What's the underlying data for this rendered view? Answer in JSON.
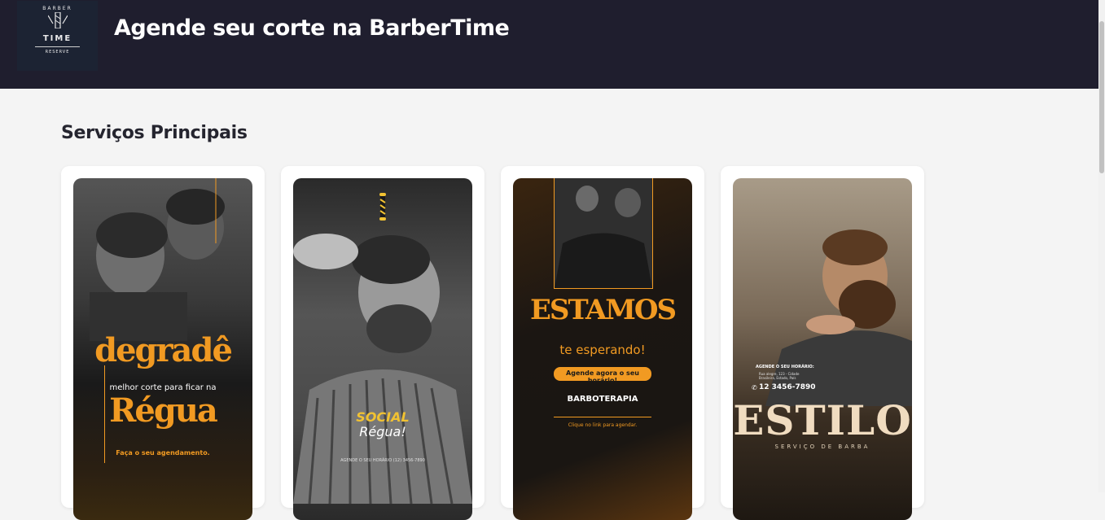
{
  "header": {
    "title": "Agende seu corte na BarberTime",
    "logo": {
      "line1": "BARBER",
      "line2": "TIME",
      "line3": "RESERVE"
    }
  },
  "section": {
    "title": "Serviços Principais"
  },
  "cards": [
    {
      "headline_top": "degradê",
      "subline": "melhor corte para ficar na",
      "headline_bottom": "Régua",
      "cta": "Faça o seu agendamento."
    },
    {
      "brand_top": "SOCIAL",
      "brand_bottom": "Régua!",
      "footer": "AGENDE O SEU HORÁRIO (12) 3456-7890"
    },
    {
      "headline": "ESTAMOS",
      "subline": "te esperando!",
      "button": "Agende agora o seu horário!",
      "service": "BARBOTERAPIA",
      "link": "Clique no link para agendar."
    },
    {
      "info_title": "AGENDE O SEU HORÁRIO:",
      "address": "Rua alegre, 123 - Cidade Brasileira, Estado, País",
      "phone": "12 3456-7890",
      "headline": "ESTILO",
      "subline": "SERVIÇO DE BARBA"
    }
  ],
  "colors": {
    "header_bg": "#1f1e2e",
    "accent": "#f19a22",
    "page_bg": "#f4f4f4"
  }
}
